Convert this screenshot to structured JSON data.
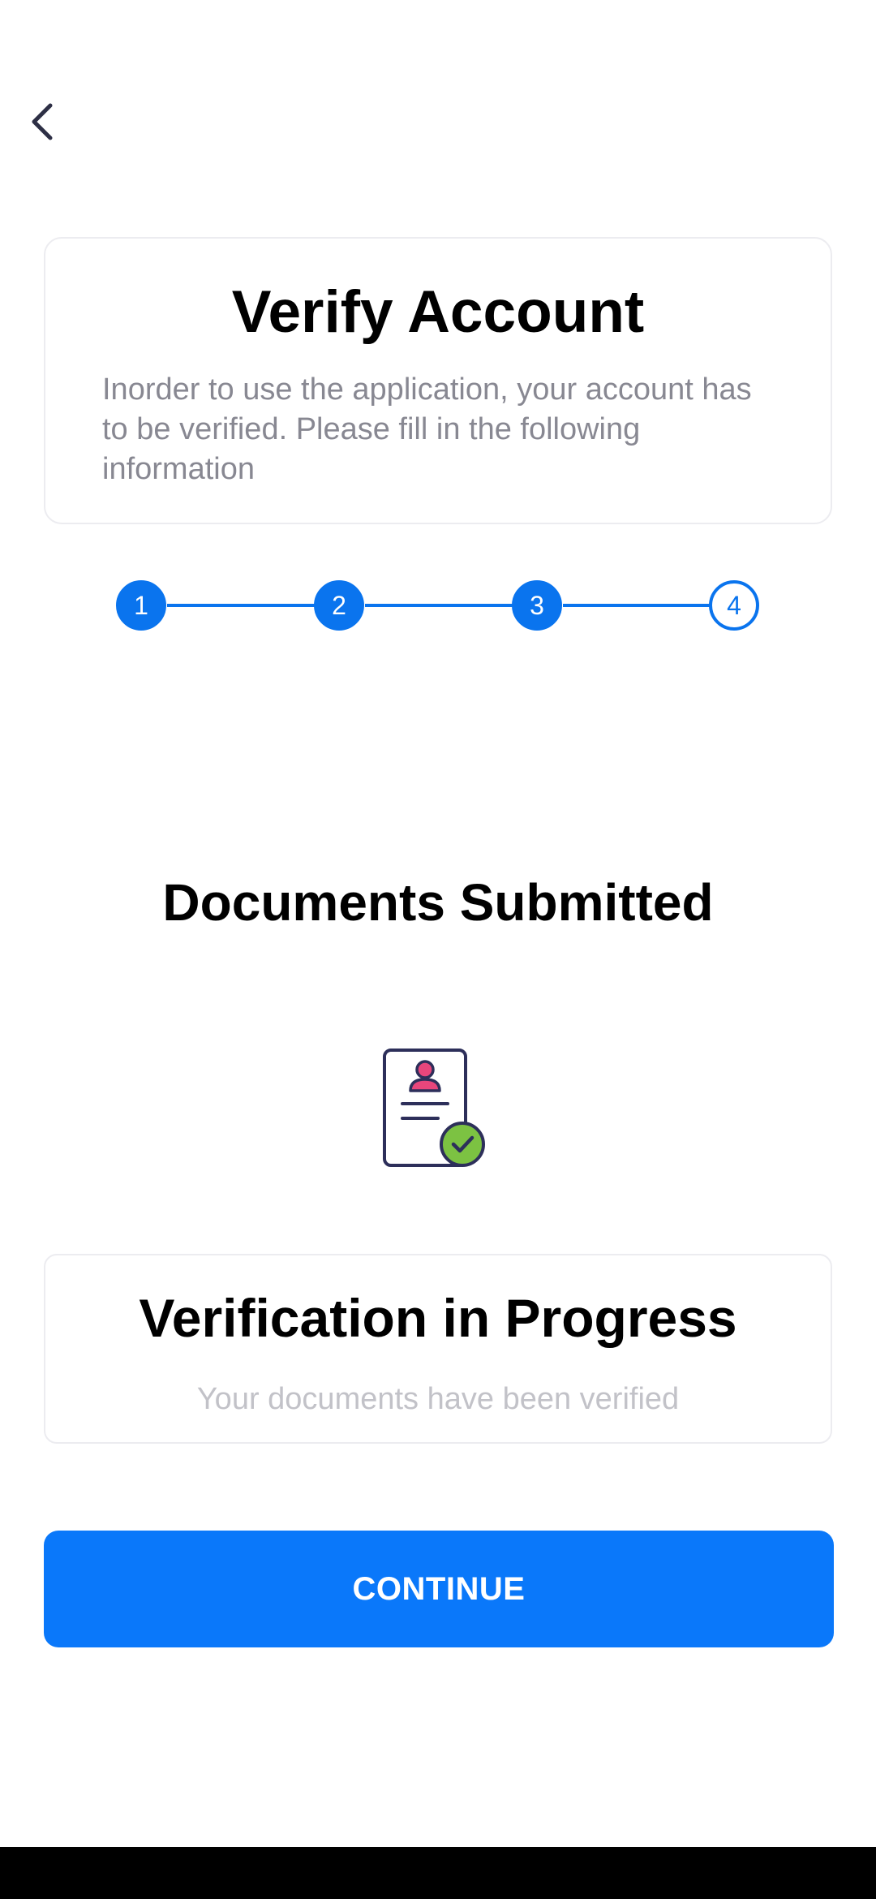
{
  "header": {
    "title": "Verify Account",
    "description": "Inorder to use the application, your account has to be verified. Please fill in the following information"
  },
  "stepper": {
    "steps": [
      {
        "label": "1",
        "state": "done"
      },
      {
        "label": "2",
        "state": "done"
      },
      {
        "label": "3",
        "state": "done"
      },
      {
        "label": "4",
        "state": "current"
      }
    ],
    "accent": "#0a74ee"
  },
  "section": {
    "title": "Documents Submitted",
    "icon": "document-verified-icon"
  },
  "status": {
    "title": "Verification in Progress",
    "subtitle": "Your documents have been verified"
  },
  "actions": {
    "continue_label": "CONTINUE"
  },
  "icons": {
    "back": "chevron-left-icon"
  },
  "colors": {
    "primary_button": "#0a78fa",
    "avatar": "#e8467c",
    "check_badge": "#7cc242",
    "icon_outline": "#2d2f5a"
  }
}
